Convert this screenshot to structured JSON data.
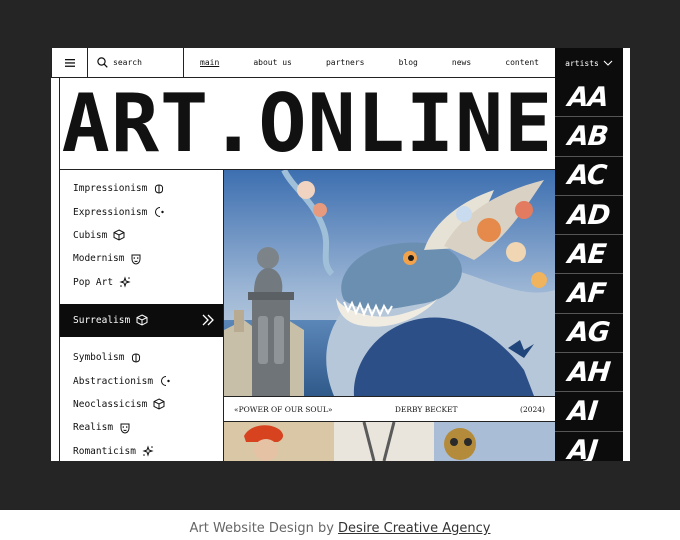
{
  "header": {
    "search_placeholder": "search",
    "nav": [
      "main",
      "about us",
      "partners",
      "blog",
      "news",
      "content"
    ],
    "active_nav": "main",
    "artists_label": "artists"
  },
  "title": "ART.ONLINE",
  "letters": [
    "AA",
    "AB",
    "AC",
    "AD",
    "AE",
    "AF",
    "AG",
    "AH",
    "AI",
    "AJ"
  ],
  "sidebar": {
    "styles": [
      {
        "label": "Impressionism",
        "icon": "brain-icon"
      },
      {
        "label": "Expressionism",
        "icon": "crescent-icon"
      },
      {
        "label": "Cubism",
        "icon": "cube-icon"
      },
      {
        "label": "Modernism",
        "icon": "mask-icon"
      },
      {
        "label": "Pop Art",
        "icon": "sparkle-icon"
      },
      {
        "label": "Surrealism",
        "icon": "cube-icon",
        "selected": true
      },
      {
        "label": "Symbolism",
        "icon": "brain-icon"
      },
      {
        "label": "Abstractionism",
        "icon": "crescent-icon"
      },
      {
        "label": "Neoclassicism",
        "icon": "cube-icon"
      },
      {
        "label": "Realism",
        "icon": "mask-icon"
      },
      {
        "label": "Romanticism",
        "icon": "sparkle-icon"
      }
    ]
  },
  "caption": {
    "title": "«POWER OF OUR SOUL»",
    "artist": "DERBY BECKET",
    "year": "(2024)"
  },
  "credit": {
    "prefix": "Art Website Design by",
    "agency": "Desire Creative Agency"
  },
  "colors": {
    "background": "#252525",
    "panel": "#0c0c0c",
    "text": "#111111"
  }
}
